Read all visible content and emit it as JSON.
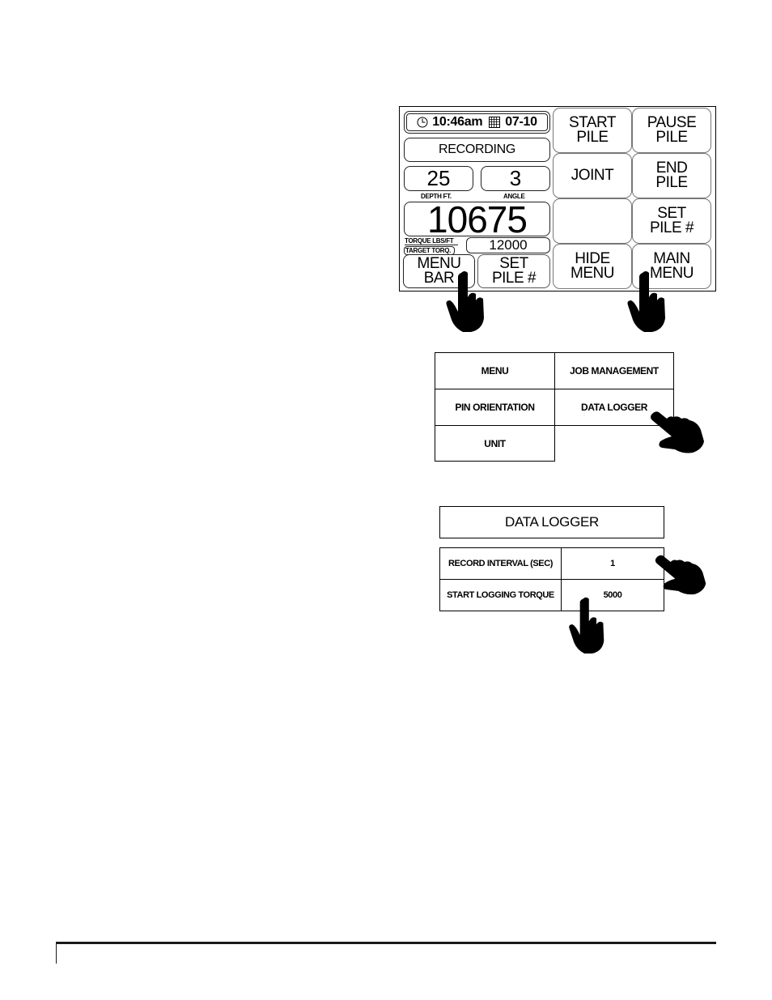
{
  "screen": {
    "clock_icon": "clock-icon",
    "time": "10:46am",
    "calendar_icon": "calendar-icon",
    "date": "07-10",
    "status": "RECORDING",
    "depth_value": "25",
    "depth_label": "DEPTH FT.",
    "angle_value": "3",
    "angle_label": "ANGLE",
    "torque_value": "10675",
    "torque_label": "TORQUE  LBS/FT",
    "target_label": "TARGET TORQ.",
    "target_value": "12000",
    "menu_bar_line1": "MENU",
    "menu_bar_line2": "BAR",
    "set_pile_line1": "SET",
    "set_pile_line2": "PILE #",
    "buttons": {
      "start_pile": [
        "START",
        "PILE"
      ],
      "pause_pile": [
        "PAUSE",
        "PILE"
      ],
      "joint": "JOINT",
      "end_pile": [
        "END",
        "PILE"
      ],
      "blank": "",
      "set_pile": [
        "SET",
        "PILE #"
      ],
      "hide_menu": [
        "HIDE",
        "MENU"
      ],
      "main_menu": [
        "MAIN",
        "MENU"
      ]
    }
  },
  "menu": {
    "items": [
      "MENU",
      "JOB MANAGEMENT",
      "PIN ORIENTATION",
      "DATA LOGGER",
      "UNIT"
    ]
  },
  "data_logger": {
    "title": "DATA LOGGER",
    "rows": [
      {
        "label": "RECORD INTERVAL (SEC)",
        "value": "1"
      },
      {
        "label": "START LOGGING TORQUE",
        "value": "5000"
      }
    ]
  }
}
